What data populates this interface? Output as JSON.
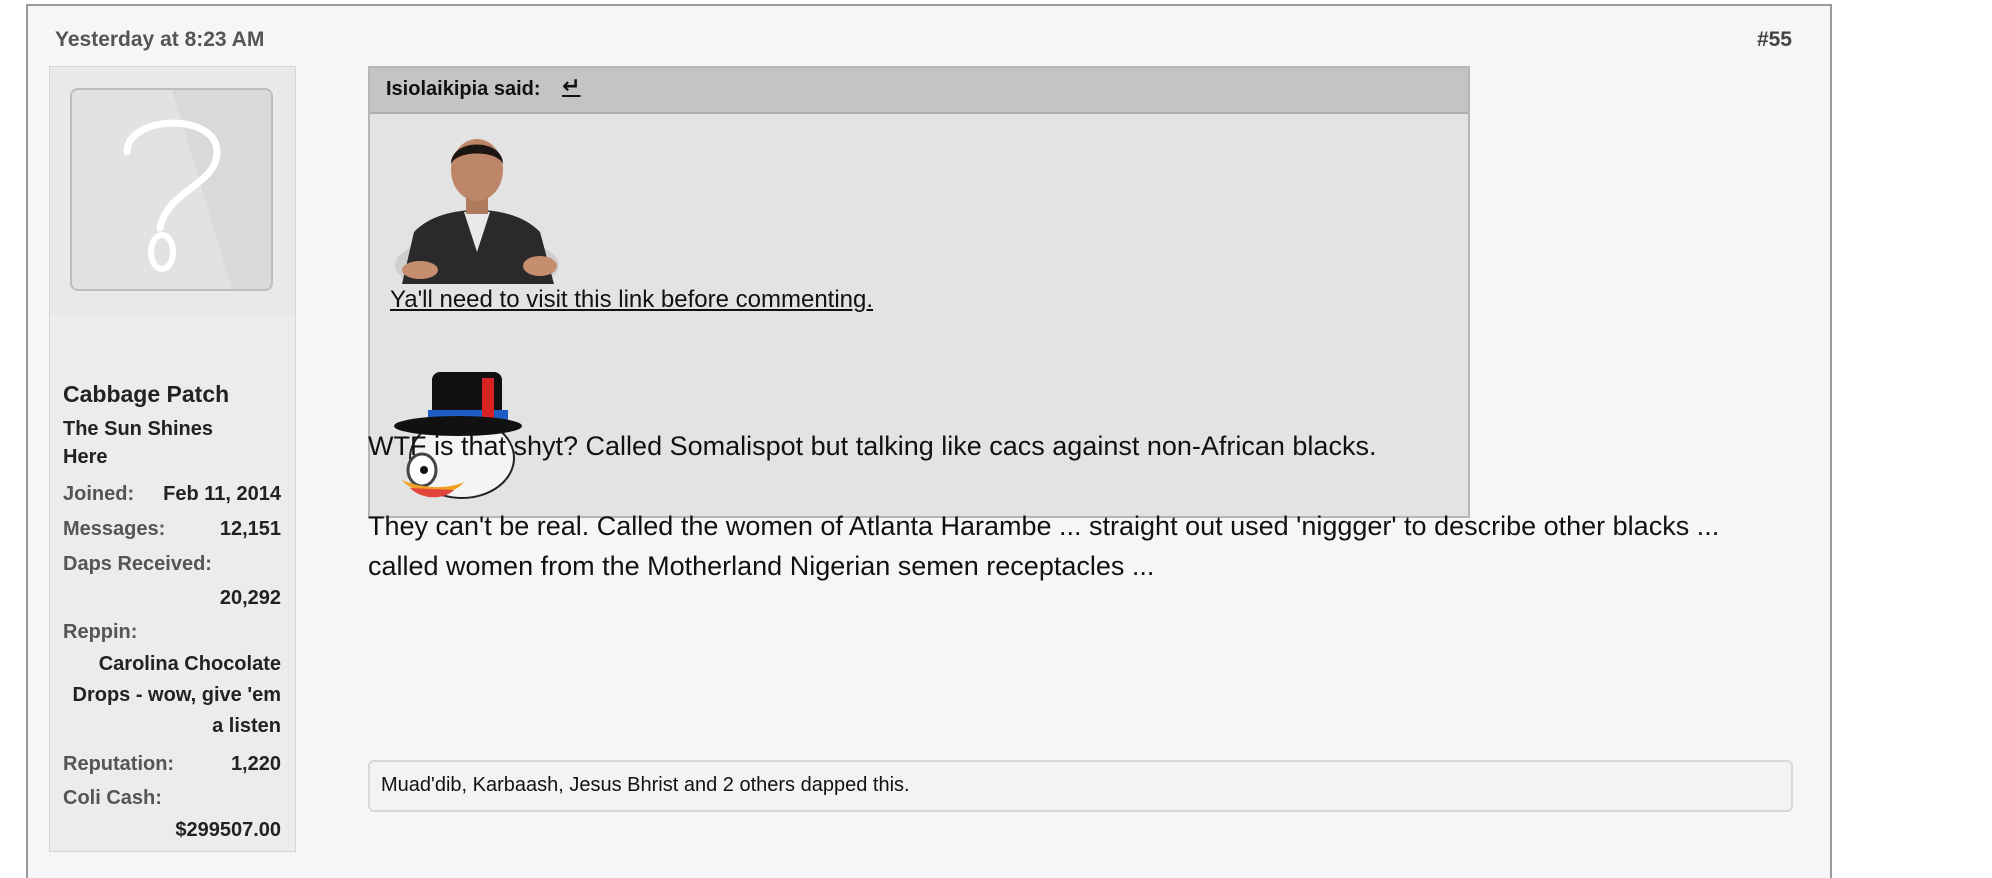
{
  "post": {
    "date": "Yesterday at 8:23 AM",
    "number": "#55"
  },
  "user": {
    "username": "Cabbage Patch",
    "title": "The Sun Shines Here",
    "avatar_icon": "question-mark-avatar",
    "stats": {
      "joined_label": "Joined:",
      "joined_value": "Feb 11, 2014",
      "messages_label": "Messages:",
      "messages_value": "12,151",
      "daps_label": "Daps Received:",
      "daps_value": "20,292",
      "reppin_label": "Reppin:",
      "reppin_value": "Carolina Chocolate Drops - wow, give 'em a listen",
      "reputation_label": "Reputation:",
      "reputation_value": "1,220",
      "colicash_label": "Coli Cash:",
      "colicash_value": "$299507.00"
    }
  },
  "quote": {
    "author": "Isiolaikipia said:",
    "jump_glyph": "↵",
    "link_text": "Ya'll need to visit this link before commenting."
  },
  "message": {
    "paragraph1": "WTF is that shyt? Called Somalispot but talking like cacs against non-African blacks.",
    "paragraph2": "They can't be real. Called the women of Atlanta Harambe ... straight out used 'niggger' to describe other blacks ... called women from the Motherland Nigerian semen receptacles ..."
  },
  "likes": {
    "text": "Muad'dib, Karbaash, Jesus Bhrist and 2 others dapped this."
  }
}
